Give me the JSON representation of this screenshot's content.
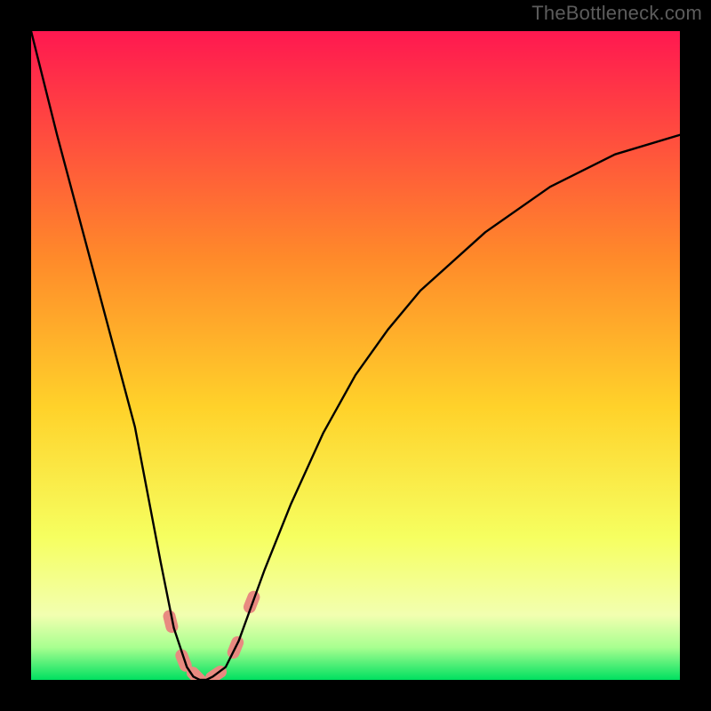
{
  "watermark": "TheBottleneck.com",
  "chart_data": {
    "type": "line",
    "title": "",
    "xlabel": "",
    "ylabel": "",
    "xlim": [
      0,
      100
    ],
    "ylim": [
      0,
      100
    ],
    "background_gradient": {
      "top": "#ff1850",
      "upper_mid": "#ff8a2a",
      "mid": "#ffd22a",
      "lower_mid": "#f6ff60",
      "pale": "#f2ffb0",
      "green_pale": "#a8ff90",
      "green": "#00e060"
    },
    "series": [
      {
        "name": "bottleneck-curve",
        "x": [
          0,
          4,
          8,
          12,
          16,
          20,
          22,
          24,
          25,
          26,
          27,
          28,
          30,
          32,
          36,
          40,
          45,
          50,
          55,
          60,
          70,
          80,
          90,
          100
        ],
        "y": [
          100,
          84,
          69,
          54,
          39,
          18,
          8,
          2,
          0.5,
          0,
          0,
          0.5,
          2,
          6,
          17,
          27,
          38,
          47,
          54,
          60,
          69,
          76,
          81,
          84
        ],
        "color": "#000000"
      }
    ],
    "markers": [
      {
        "name": "marker-1",
        "x": 21.5,
        "y": 9,
        "color": "#e88a80"
      },
      {
        "name": "marker-2",
        "x": 23.5,
        "y": 3,
        "color": "#e88a80"
      },
      {
        "name": "marker-3",
        "x": 25.5,
        "y": 0.5,
        "color": "#e88a80"
      },
      {
        "name": "marker-4",
        "x": 28.5,
        "y": 0.8,
        "color": "#e88a80"
      },
      {
        "name": "marker-5",
        "x": 31.5,
        "y": 5,
        "color": "#e88a80"
      },
      {
        "name": "marker-6",
        "x": 34,
        "y": 12,
        "color": "#e88a80"
      }
    ]
  }
}
